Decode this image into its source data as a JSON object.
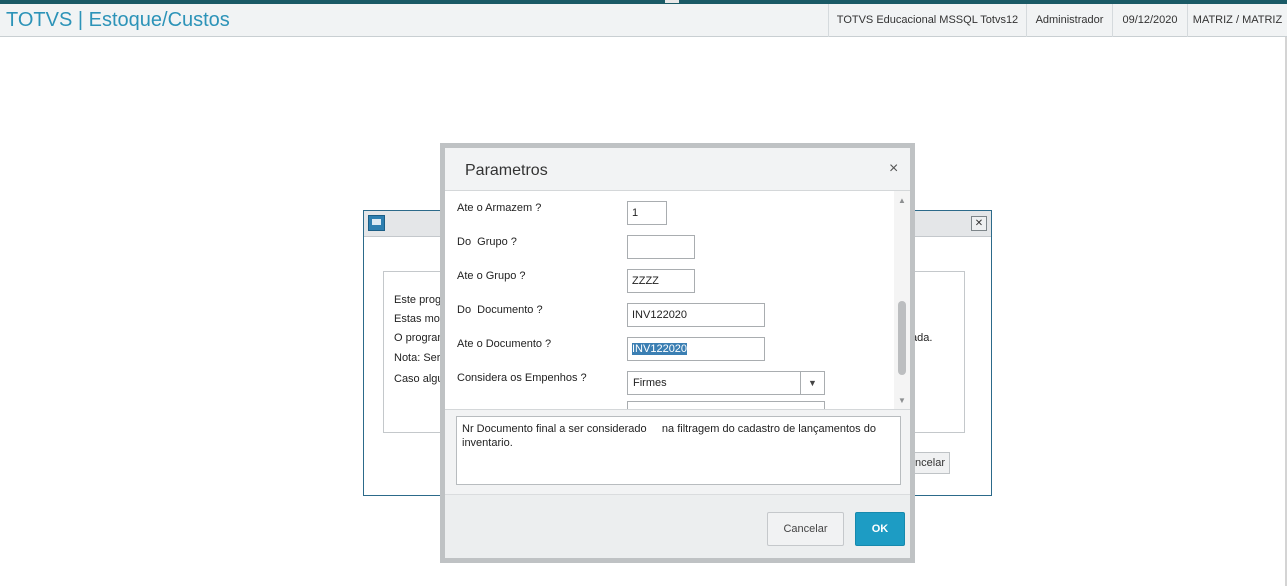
{
  "header": {
    "app_title": "TOTVS | Estoque/Custos",
    "environment": "TOTVS Educacional MSSQL Totvs12",
    "user": "Administrador",
    "date": "09/12/2020",
    "branch": "MATRIZ / MATRIZ"
  },
  "background_dialog": {
    "lines": [
      "Este prog",
      "Estas mov",
      "O progran",
      "Nota: Ser",
      "Caso algu"
    ],
    "line3_tail": "ada.",
    "cancel_label": "ncelar"
  },
  "modal": {
    "title": "Parametros",
    "close_glyph": "×",
    "params": [
      {
        "label": "Ate o Armazem ?",
        "value": "1"
      },
      {
        "label": "Do  Grupo ?",
        "value": ""
      },
      {
        "label": "Ate o Grupo ?",
        "value": "ZZZZ"
      },
      {
        "label": "Do  Documento ?",
        "value": "INV122020"
      },
      {
        "label": "Ate o Documento ?",
        "value": "INV122020"
      },
      {
        "label": "Considera os Empenhos ?",
        "value": "Firmes"
      }
    ],
    "help_text": "Nr Documento final a ser considerado     na filtragem do cadastro de lançamentos do inventario.",
    "cancel_label": "Cancelar",
    "ok_label": "OK"
  },
  "colors": {
    "accent": "#2c93b8",
    "ok_button": "#1d9cc4",
    "selection": "#3b7fb3"
  }
}
